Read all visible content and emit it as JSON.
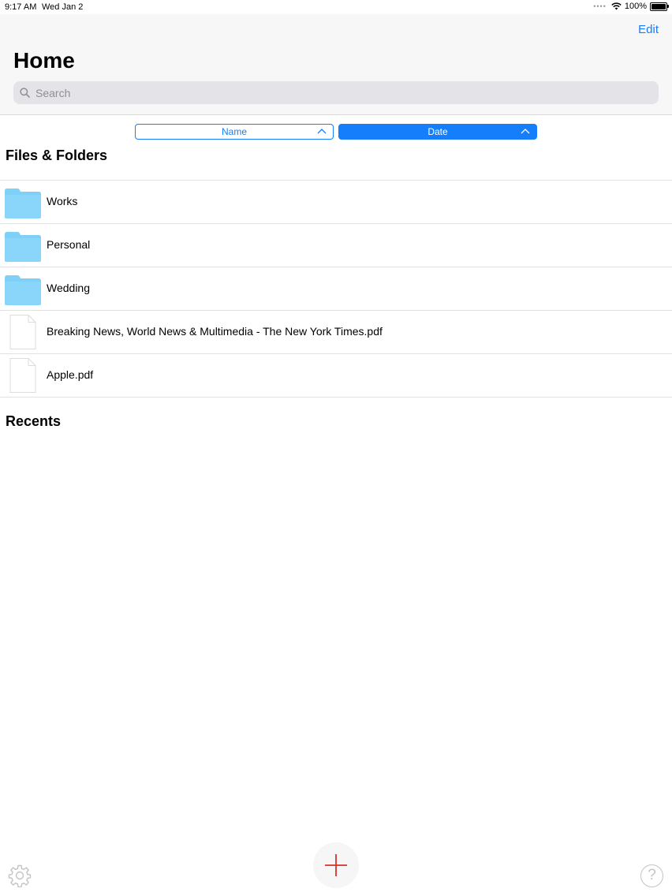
{
  "status_bar": {
    "time": "9:17 AM",
    "date": "Wed Jan 2",
    "battery": "100%",
    "icons": [
      "signal-dots-icon",
      "wifi-icon",
      "battery-icon"
    ]
  },
  "nav": {
    "title": "Home",
    "edit_label": "Edit",
    "search_placeholder": "Search"
  },
  "sort": {
    "name_label": "Name",
    "date_label": "Date",
    "active": "Date"
  },
  "sections": {
    "files_title": "Files & Folders",
    "recents_title": "Recents"
  },
  "items": [
    {
      "type": "folder",
      "name": "Works"
    },
    {
      "type": "folder",
      "name": "Personal"
    },
    {
      "type": "folder",
      "name": "Wedding"
    },
    {
      "type": "file",
      "name": "Breaking News, World News & Multimedia - The New York Times.pdf"
    },
    {
      "type": "file",
      "name": "Apple.pdf"
    }
  ],
  "bottom_bar": {
    "help_label": "?",
    "icons": [
      "gear-icon",
      "plus-icon",
      "help-icon"
    ]
  },
  "colors": {
    "accent": "#147efb",
    "folder": "#7fd0f7",
    "add": "#d9302b"
  }
}
